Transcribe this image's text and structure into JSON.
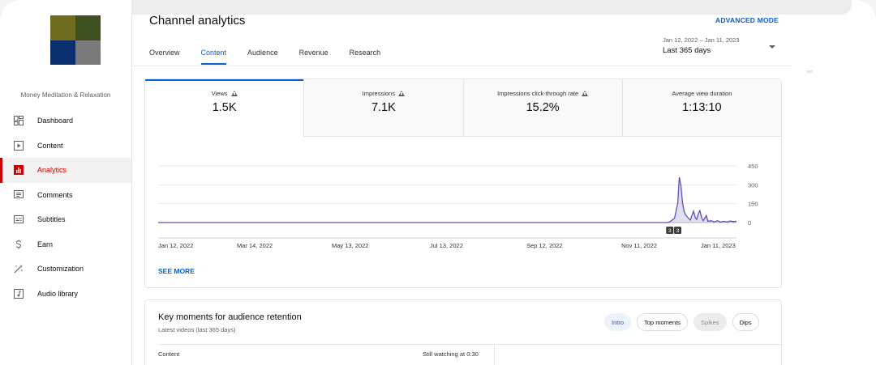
{
  "sidebar": {
    "channel_name": "Money Meditation & Relaxation",
    "avatar_colors": [
      "#6e6a1e",
      "#3f5020",
      "#0b2e6e",
      "#7a7a7a"
    ],
    "items": [
      {
        "label": "Dashboard",
        "icon": "dashboard-icon"
      },
      {
        "label": "Content",
        "icon": "content-icon"
      },
      {
        "label": "Analytics",
        "icon": "analytics-icon",
        "active": true
      },
      {
        "label": "Comments",
        "icon": "comments-icon"
      },
      {
        "label": "Subtitles",
        "icon": "subtitles-icon"
      },
      {
        "label": "Earn",
        "icon": "earn-icon"
      },
      {
        "label": "Customization",
        "icon": "customization-icon"
      },
      {
        "label": "Audio library",
        "icon": "audio-library-icon"
      }
    ]
  },
  "header": {
    "title": "Channel analytics",
    "advanced_mode": "ADVANCED MODE",
    "tabs": [
      "Overview",
      "Content",
      "Audience",
      "Revenue",
      "Research"
    ],
    "active_tab": "Content",
    "date_range_caption": "Jan 12, 2022 – Jan 11, 2023",
    "date_range_value": "Last 365 days"
  },
  "metrics": [
    {
      "label": "Views",
      "value": "1.5K",
      "warning": true
    },
    {
      "label": "Impressions",
      "value": "7.1K",
      "warning": true
    },
    {
      "label": "Impressions click-through rate",
      "value": "15.2%",
      "warning": true
    },
    {
      "label": "Average view duration",
      "value": "1:13:10",
      "warning": false
    }
  ],
  "chart_data": {
    "type": "line",
    "x_labels": [
      "Jan 12, 2022",
      "Mar 14, 2022",
      "May 13, 2022",
      "Jul 13, 2022",
      "Sep 12, 2022",
      "Nov 11, 2022",
      "Jan 11, 2023"
    ],
    "y_ticks": [
      450,
      300,
      150,
      0
    ],
    "ylim": [
      0,
      450
    ],
    "x_day_range": [
      0,
      364
    ],
    "series": [
      {
        "color": "#5b53b8",
        "points": [
          [
            0,
            0
          ],
          [
            320,
            0
          ],
          [
            322,
            5
          ],
          [
            325,
            35
          ],
          [
            327,
            150
          ],
          [
            328,
            360
          ],
          [
            329,
            300
          ],
          [
            330,
            160
          ],
          [
            331,
            90
          ],
          [
            332,
            60
          ],
          [
            333,
            45
          ],
          [
            334,
            30
          ],
          [
            335,
            20
          ],
          [
            336,
            60
          ],
          [
            337,
            90
          ],
          [
            338,
            40
          ],
          [
            339,
            25
          ],
          [
            340,
            70
          ],
          [
            341,
            95
          ],
          [
            342,
            40
          ],
          [
            343,
            15
          ],
          [
            344,
            35
          ],
          [
            345,
            55
          ],
          [
            346,
            10
          ],
          [
            348,
            15
          ],
          [
            350,
            5
          ],
          [
            352,
            15
          ],
          [
            354,
            4
          ],
          [
            356,
            10
          ],
          [
            358,
            5
          ],
          [
            360,
            12
          ],
          [
            362,
            8
          ],
          [
            364,
            10
          ]
        ]
      }
    ],
    "annotations": [
      {
        "label": "3",
        "x": 322
      },
      {
        "label": "3",
        "x": 327
      }
    ],
    "grid": true
  },
  "see_more": "SEE MORE",
  "key_moments": {
    "title": "Key moments for audience retention",
    "subtitle": "Latest videos (last 365 days)",
    "chips": [
      {
        "label": "Intro",
        "state": "selected"
      },
      {
        "label": "Top moments",
        "state": "normal"
      },
      {
        "label": "Spikes",
        "state": "disabled"
      },
      {
        "label": "Dips",
        "state": "normal"
      }
    ],
    "columns": [
      "Content",
      "Still watching at 0:30"
    ]
  }
}
